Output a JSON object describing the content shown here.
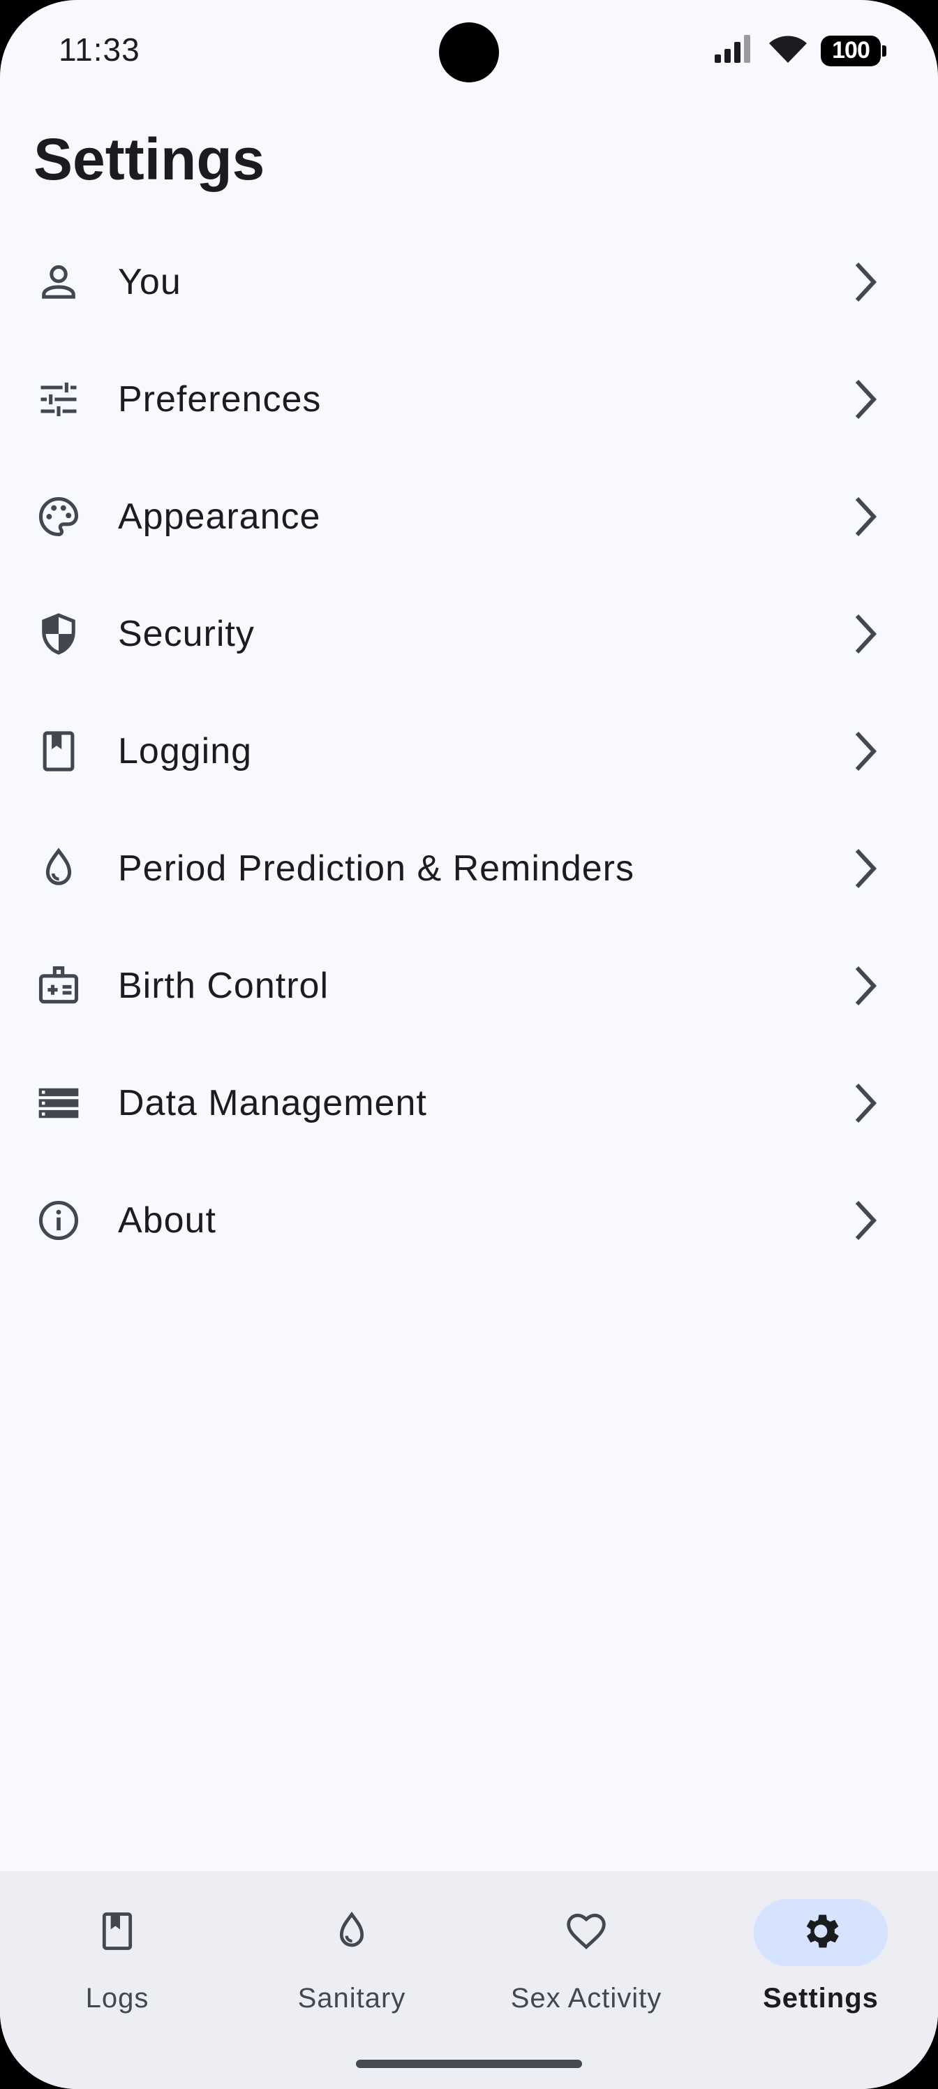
{
  "status_bar": {
    "time": "11:33",
    "battery": "100"
  },
  "page": {
    "title": "Settings"
  },
  "settings": {
    "items": [
      {
        "label": "You",
        "icon": "person-icon"
      },
      {
        "label": "Preferences",
        "icon": "tune-icon"
      },
      {
        "label": "Appearance",
        "icon": "palette-icon"
      },
      {
        "label": "Security",
        "icon": "shield-icon"
      },
      {
        "label": "Logging",
        "icon": "bookmark-book-icon"
      },
      {
        "label": "Period Prediction & Reminders",
        "icon": "drop-icon"
      },
      {
        "label": "Birth Control",
        "icon": "medical-kit-icon"
      },
      {
        "label": "Data Management",
        "icon": "storage-icon"
      },
      {
        "label": "About",
        "icon": "info-icon"
      }
    ]
  },
  "bottom_nav": {
    "items": [
      {
        "label": "Logs",
        "icon": "bookmark-book-icon",
        "active": false
      },
      {
        "label": "Sanitary",
        "icon": "drop-icon",
        "active": false
      },
      {
        "label": "Sex Activity",
        "icon": "heart-icon",
        "active": false
      },
      {
        "label": "Settings",
        "icon": "gear-icon",
        "active": true
      }
    ]
  },
  "colors": {
    "background": "#f8f9ff",
    "nav_background": "#eceef4",
    "active_indicator": "#d6e3ff",
    "text": "#1b1c20",
    "icon": "#44474e"
  }
}
